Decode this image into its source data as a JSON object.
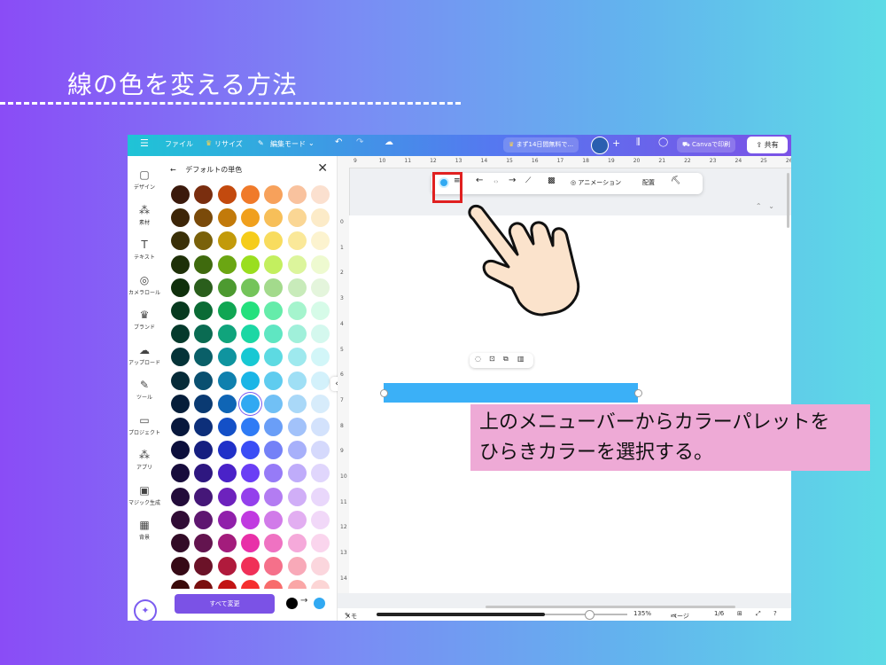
{
  "slide": {
    "title": "線の色を変える方法"
  },
  "topbar": {
    "menu": "☰",
    "file": "ファイル",
    "resize": "リサイズ",
    "edit": "編集モード",
    "trial": "まず14日間無料で...",
    "print": "Canvaで印刷",
    "share": "共有"
  },
  "rail": {
    "items": [
      {
        "icon": "▢",
        "label": "デザイン"
      },
      {
        "icon": "⁂",
        "label": "素材"
      },
      {
        "icon": "T",
        "label": "テキスト"
      },
      {
        "icon": "◎",
        "label": "カメラロール"
      },
      {
        "icon": "♛",
        "label": "ブランド"
      },
      {
        "icon": "☁",
        "label": "アップロード"
      },
      {
        "icon": "✎",
        "label": "ツール"
      },
      {
        "icon": "▭",
        "label": "プロジェクト"
      },
      {
        "icon": "⁂",
        "label": "アプリ"
      },
      {
        "icon": "▣",
        "label": "マジック生成"
      },
      {
        "icon": "▦",
        "label": "背景"
      }
    ],
    "magic_icon": "✦"
  },
  "panel": {
    "back": "←",
    "title": "デフォルトの単色",
    "close": "✕",
    "selected_row": 9,
    "selected_col": 3,
    "colors": [
      [
        "#3b1a0c",
        "#7a2e0f",
        "#c34a0e",
        "#f07a2a",
        "#f7a15b",
        "#f9c29e",
        "#fbe0cf"
      ],
      [
        "#3d2608",
        "#7a4a0a",
        "#c27a0a",
        "#f0a01d",
        "#f7bf59",
        "#fad694",
        "#fcebc8"
      ],
      [
        "#3a3008",
        "#7a610a",
        "#c29a0a",
        "#f5cc1a",
        "#f8dc5e",
        "#fae899",
        "#fcf3cf"
      ],
      [
        "#1e3008",
        "#3f6a0e",
        "#6ba612",
        "#9ade1f",
        "#c3ef5f",
        "#dcf59c",
        "#eefad0"
      ],
      [
        "#10300c",
        "#2a5e1c",
        "#4d9a30",
        "#74c45a",
        "#a3da8c",
        "#c8ebba",
        "#e4f5dc"
      ],
      [
        "#073a1f",
        "#0b6b35",
        "#10a653",
        "#24e07d",
        "#65ecaa",
        "#a5f4cd",
        "#d6fbe8"
      ],
      [
        "#053a2c",
        "#0a6b52",
        "#10a47c",
        "#1cd7a4",
        "#5fe6c2",
        "#a0f0da",
        "#d4f8ee"
      ],
      [
        "#053338",
        "#0a5f68",
        "#0f949f",
        "#18c8d3",
        "#5ddae2",
        "#9ee9ee",
        "#d2f6f8"
      ],
      [
        "#062b38",
        "#0a5070",
        "#0f80ae",
        "#1ab5e6",
        "#5fccef",
        "#9fdff5",
        "#d3f1fb"
      ],
      [
        "#061e3a",
        "#0a3a72",
        "#0f65b5",
        "#31a9f2",
        "#71c0f5",
        "#a9d8f8",
        "#d7ecfb"
      ],
      [
        "#08183c",
        "#0d2f7a",
        "#1450c7",
        "#2f7bf5",
        "#6a9ef7",
        "#a2c2fa",
        "#d3e2fc"
      ],
      [
        "#0c0f3c",
        "#161f80",
        "#2030c8",
        "#3a4df5",
        "#7481f7",
        "#a7b0fa",
        "#d5d9fc"
      ],
      [
        "#170c3c",
        "#2e1780",
        "#4a22c8",
        "#6a3ef5",
        "#967bf7",
        "#bfacfa",
        "#e0d6fc"
      ],
      [
        "#230c3a",
        "#451778",
        "#6d22bd",
        "#9440ec",
        "#b37cf2",
        "#d0aef7",
        "#e9d7fb"
      ],
      [
        "#300c35",
        "#5e1770",
        "#9020aa",
        "#c03ae0",
        "#d17be9",
        "#e2aef1",
        "#f1d8f8"
      ],
      [
        "#320b27",
        "#63144f",
        "#a31c7c",
        "#e830a8",
        "#ef72c2",
        "#f5a9da",
        "#fad5ed"
      ],
      [
        "#360a16",
        "#6b1228",
        "#b01a3c",
        "#f03058",
        "#f5708a",
        "#f8a9b8",
        "#fbd6dd"
      ],
      [
        "#3a0a0a",
        "#7a0f0f",
        "#c21414",
        "#f52e2e",
        "#f86c6c",
        "#faa7a7",
        "#fcd5d5"
      ]
    ],
    "change_all": "すべて変更",
    "swap_arrow": "→"
  },
  "rulers": {
    "top": [
      "9",
      "10",
      "11",
      "12",
      "13",
      "14",
      "15",
      "16",
      "17",
      "18",
      "19",
      "20",
      "21",
      "22",
      "23",
      "24",
      "25",
      "26"
    ],
    "left": [
      "0",
      "1",
      "2",
      "3",
      "4",
      "5",
      "6",
      "7",
      "8",
      "9",
      "10",
      "11",
      "12",
      "13",
      "14"
    ]
  },
  "toolbar": {
    "animation": "アニメーション",
    "arrange": "配置"
  },
  "bottombar": {
    "memo": "メモ",
    "zoom": "135%",
    "pages": "ページ",
    "page_count": "1/6"
  },
  "callout": {
    "line1": "上のメニューバーからカラーパレットを",
    "line2": "ひらきカラーを選択する。"
  }
}
